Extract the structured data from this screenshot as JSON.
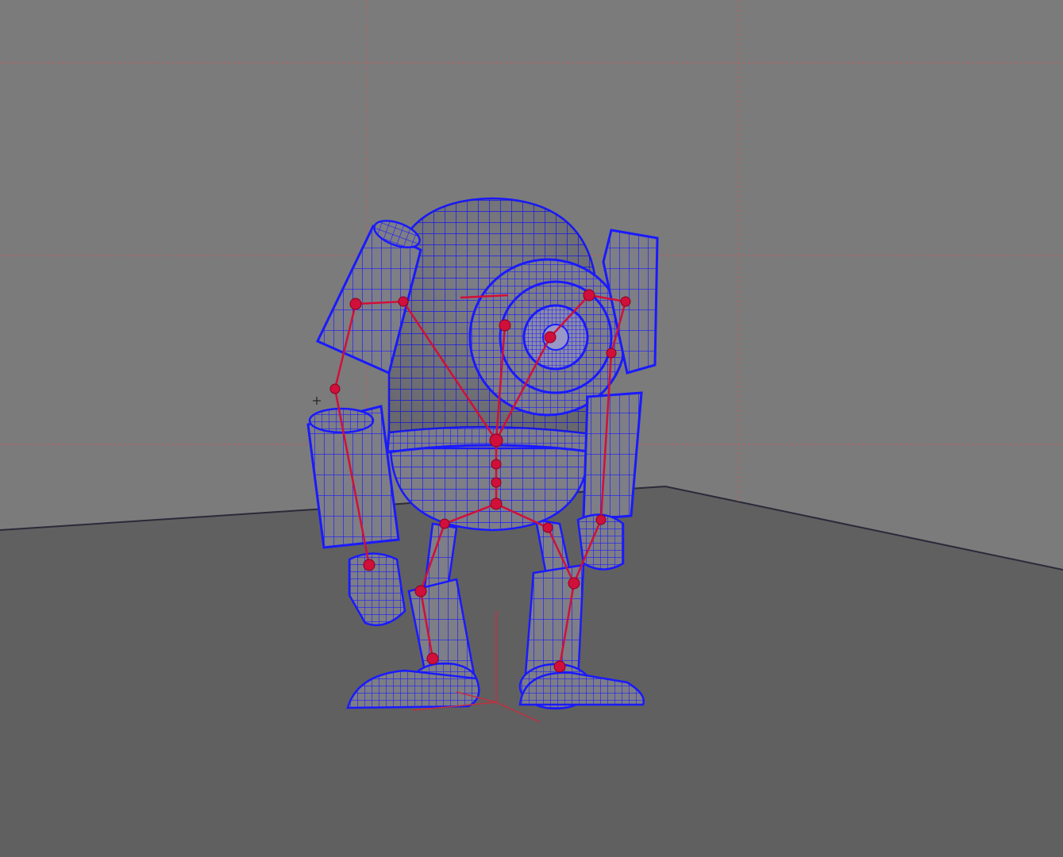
{
  "viewport": {
    "background_color": "#7b7b7b",
    "floor_color": "#606060",
    "grid_color": "#c05858",
    "wireframe_color": "#1a1aff",
    "joint_color": "#d0103a"
  },
  "scene": {
    "model": "robot-character",
    "display_mode": "wireframe-on-shaded",
    "skeleton_visible": true,
    "grid_visible": true
  }
}
